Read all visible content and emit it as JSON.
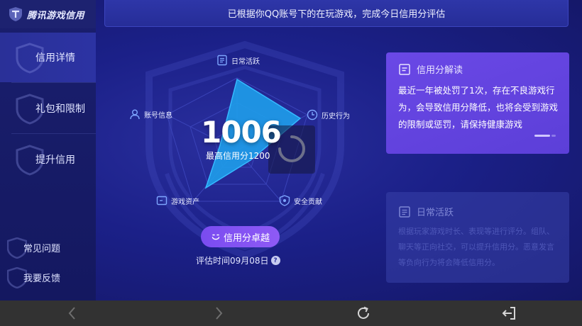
{
  "app": {
    "title": "腾讯游戏信用"
  },
  "sidebar": {
    "items": [
      {
        "label": "信用详情"
      },
      {
        "label": "礼包和限制"
      },
      {
        "label": "提升信用"
      }
    ],
    "footer": [
      {
        "label": "常见问题"
      },
      {
        "label": "我要反馈"
      }
    ]
  },
  "banner": {
    "text": "已根据你QQ账号下的在玩游戏，完成今日信用分评估"
  },
  "radar": {
    "axes": [
      {
        "label": "日常活跃",
        "icon": "document-icon"
      },
      {
        "label": "历史行为",
        "icon": "clock-icon"
      },
      {
        "label": "安全贡献",
        "icon": "shield-icon"
      },
      {
        "label": "游戏资产",
        "icon": "wallet-icon"
      },
      {
        "label": "账号信息",
        "icon": "user-icon"
      }
    ],
    "score": "1006",
    "max_label": "最高信用分1200"
  },
  "tier": {
    "label": "信用分卓越",
    "icon": "smile-icon"
  },
  "eval": {
    "text": "评估时间09月08日",
    "help": "?"
  },
  "cards": {
    "active": {
      "title": "信用分解读",
      "body": "最近一年被处罚了1次，存在不良游戏行为，会导致信用分降低，也将会受到游戏的限制或惩罚，请保持健康游戏"
    },
    "dim": {
      "title": "日常活跃",
      "body": "根据玩家游戏时长、表现等进行评分。组队、聊天等正向社交，可以提升信用分。恶意发言等负向行为将会降低信用分。"
    }
  },
  "colors": {
    "accent": "#8e5af5",
    "radar_fill": "#1e9be8",
    "card_active": "#6a48e6",
    "sysbar": "#323232"
  }
}
